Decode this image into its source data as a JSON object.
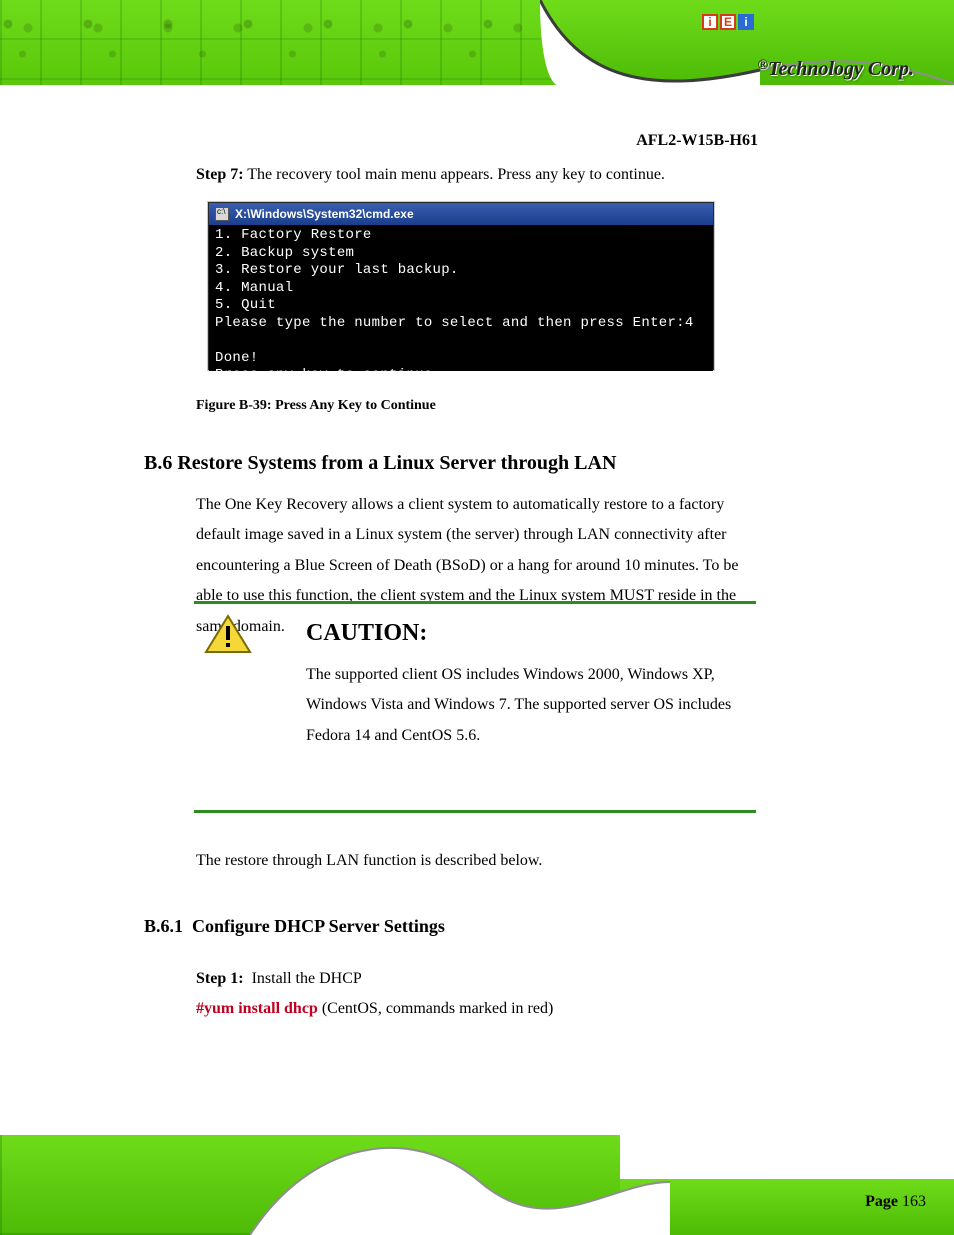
{
  "brand": {
    "reg": "®",
    "name": "Technology Corp."
  },
  "doc_title": "AFL2-W15B-H61",
  "step": {
    "prefix": "Step 7:",
    "text": "The recovery tool main menu appears. Press any key to continue."
  },
  "cmd": {
    "title": "X:\\Windows\\System32\\cmd.exe",
    "lines": [
      "1. Factory Restore",
      "2. Backup system",
      "3. Restore your last backup.",
      "4. Manual",
      "5. Quit",
      "Please type the number to select and then press Enter:4",
      "",
      "Done!",
      "Press any key to continue . . . "
    ]
  },
  "figure_caption": "Figure B-39: Press Any Key to Continue",
  "section_heading": "B.6 Restore Systems from a Linux Server through LAN",
  "para1_a": "The One Key Recovery allows a client system to automatically restore to a factory default image saved in a Linux system (the server) through LAN connectivity after encountering a Blue Screen of Death (BSoD) or a hang for around 10 minutes. To be able to use this function, the client system and the Linux system MUST reside in the same domain.",
  "caution": {
    "title": "CAUTION:",
    "body": "The supported client OS includes Windows 2000, Windows XP, Windows Vista and Windows 7. The supported server OS includes Fedora 14 and CentOS 5.6."
  },
  "para2": "The restore through LAN function is described below.",
  "section_sub": "B.6.1",
  "section_sub_title": "Configure DHCP Server Settings",
  "para3_prefix": "Step 1:",
  "para3_a": "Install the DHCP",
  "para3_b": "#yum install dhcp",
  "para3_c": " (CentOS, commands marked in red)",
  "footer": {
    "page_label": "Page ",
    "page_num": "163"
  }
}
